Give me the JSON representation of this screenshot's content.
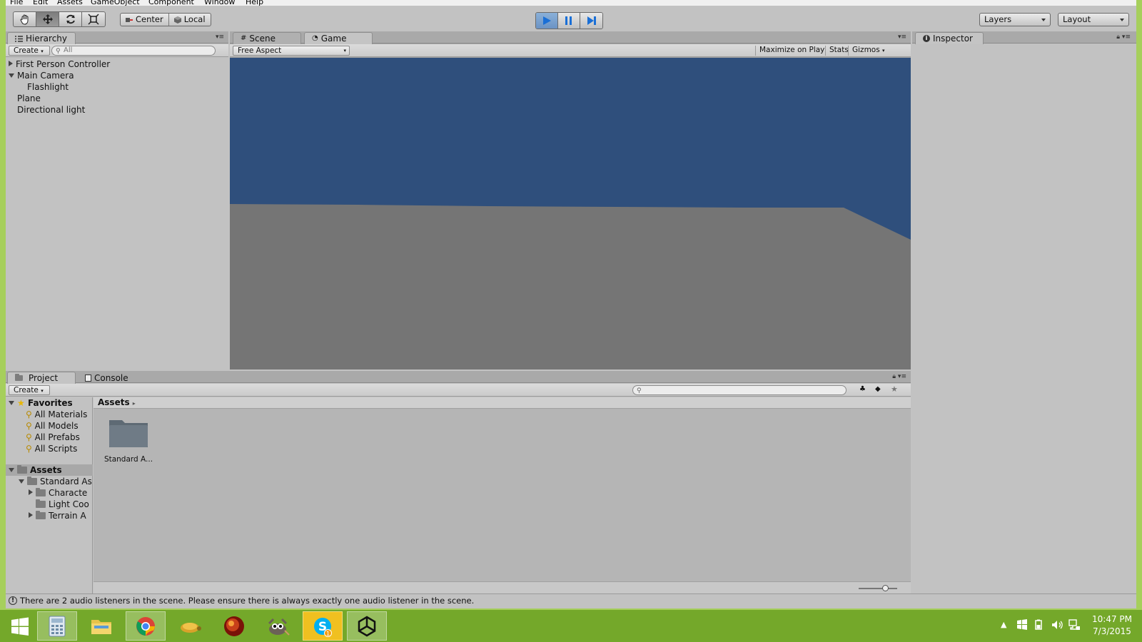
{
  "menu": [
    "File",
    "Edit",
    "Assets",
    "GameObject",
    "Component",
    "Window",
    "Help"
  ],
  "toolbar": {
    "tools": [
      "hand-icon",
      "move-icon",
      "rotate-icon",
      "scale-icon"
    ],
    "pivot_center": "Center",
    "pivot_local": "Local",
    "layers_label": "Layers",
    "layout_label": "Layout"
  },
  "hierarchy": {
    "tab_label": "Hierarchy",
    "create_label": "Create",
    "search_placeholder": "All",
    "items": [
      {
        "label": "First Person Controller"
      },
      {
        "label": "Main Camera"
      },
      {
        "label": "Flashlight"
      },
      {
        "label": "Plane"
      },
      {
        "label": "Directional light"
      }
    ]
  },
  "view": {
    "scene_tab": "Scene",
    "game_tab": "Game",
    "aspect": "Free Aspect",
    "maximize": "Maximize on Play",
    "stats": "Stats",
    "gizmos": "Gizmos",
    "sky_color": "#2f4f7c",
    "ground_color": "#757575"
  },
  "inspector": {
    "tab_label": "Inspector"
  },
  "project": {
    "project_tab": "Project",
    "console_tab": "Console",
    "create_label": "Create",
    "favorites_label": "Favorites",
    "favorites": [
      "All Materials",
      "All Models",
      "All Prefabs",
      "All Scripts"
    ],
    "assets_label": "Assets",
    "assets_tree": [
      {
        "label": "Standard As"
      },
      {
        "label": "Characte"
      },
      {
        "label": "Light Coo"
      },
      {
        "label": "Terrain A"
      }
    ],
    "breadcrumb": "Assets",
    "grid_items": [
      {
        "label": "Standard A..."
      }
    ]
  },
  "status": {
    "message": "There are 2 audio listeners in the scene. Please ensure there is always exactly one audio listener in the scene."
  },
  "taskbar": {
    "apps": [
      "start-icon",
      "calculator-icon",
      "file-explorer-icon",
      "chrome-icon",
      "turtle-app-icon",
      "red-app-icon",
      "gimp-icon",
      "skype-icon",
      "unity-icon"
    ],
    "skype_badge": "1",
    "time": "10:47 PM",
    "date": "7/3/2015"
  }
}
